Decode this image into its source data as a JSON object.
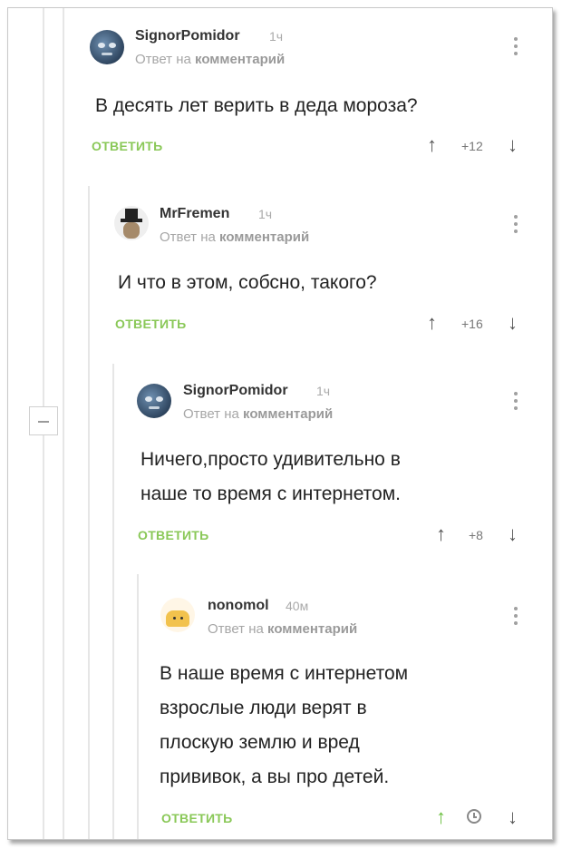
{
  "comments": [
    {
      "author": "SignorPomidor",
      "time": "1ч",
      "subtitle_prefix": "Ответ на",
      "subtitle_link": "комментарий",
      "text_lines": [
        "В десять лет верить в деда мороза?"
      ],
      "reply_label": "ОТВЕТИТЬ",
      "score": "+12",
      "avatar_icon": "moon-face-icon"
    },
    {
      "author": "MrFremen",
      "time": "1ч",
      "subtitle_prefix": "Ответ на",
      "subtitle_link": "комментарий",
      "text_lines": [
        "И что в этом, собсно, такого?"
      ],
      "reply_label": "ОТВЕТИТЬ",
      "score": "+16",
      "avatar_icon": "top-hat-icon"
    },
    {
      "author": "SignorPomidor",
      "time": "1ч",
      "subtitle_prefix": "Ответ на",
      "subtitle_link": "комментарий",
      "text_lines": [
        "Ничего,просто удивительно в",
        "наше то время с интернетом."
      ],
      "reply_label": "ОТВЕТИТЬ",
      "score": "+8",
      "avatar_icon": "moon-face-icon"
    },
    {
      "author": "nonomol",
      "time": "40м",
      "subtitle_prefix": "Ответ на",
      "subtitle_link": "комментарий",
      "text_lines": [
        "В наше время с интернетом",
        "взрослые люди верят в",
        "плоскую землю и вред",
        "прививок, а вы про детей."
      ],
      "reply_label": "ОТВЕТИТЬ",
      "score": "",
      "avatar_icon": "bread-icon"
    }
  ],
  "colors": {
    "reply_green": "#8ac858",
    "upvote_active": "#6bbf3f",
    "meta_gray": "#a6a6a6"
  },
  "icons": {
    "upvote": "↑",
    "downvote": "↓",
    "menu": "kebab-menu-icon",
    "collapse": "collapse-thread-icon",
    "pending_score": "clock-icon"
  }
}
